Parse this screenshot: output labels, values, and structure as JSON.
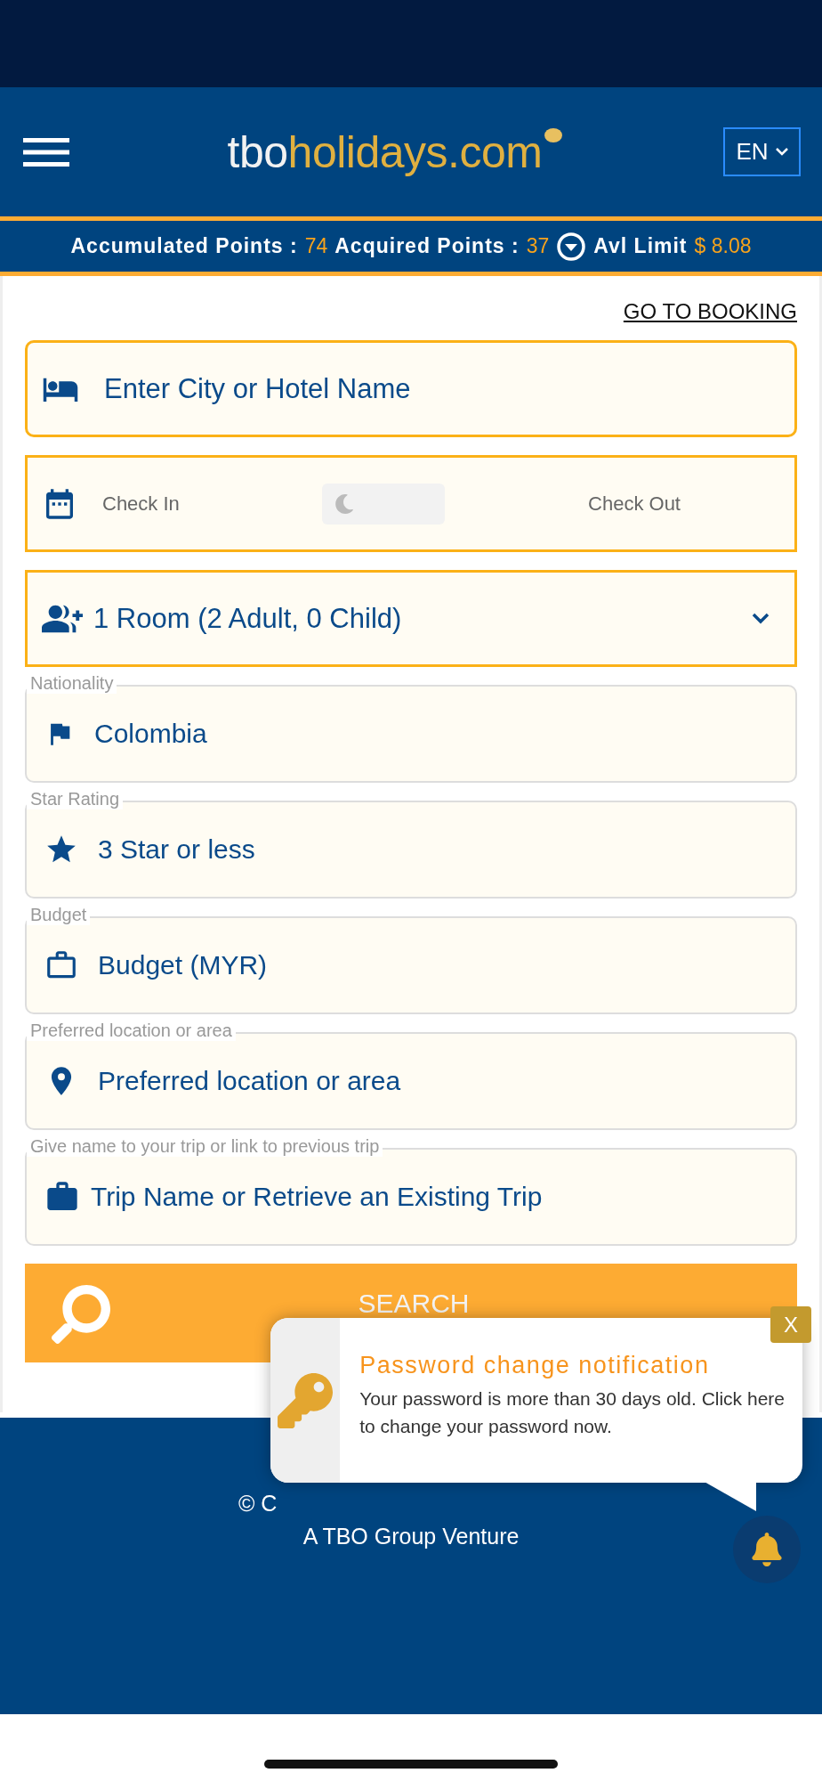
{
  "header": {
    "logo": {
      "part_1": "tbo",
      "part_2": "holidays.com"
    },
    "language": "EN"
  },
  "points_bar": {
    "items": [
      {
        "label": "Accumulated Points :",
        "value": "74"
      },
      {
        "label": "Acquired Points :",
        "value": "37"
      }
    ],
    "limit": {
      "label": "Avl Limit",
      "value": "$ 8.08"
    }
  },
  "go_to_booking": "GO TO BOOKING",
  "search_form": {
    "destination": {
      "placeholder": "Enter City or Hotel Name"
    },
    "dates": {
      "check_in": "Check In",
      "check_out": "Check Out"
    },
    "rooms": "1 Room (2 Adult, 0 Child)",
    "fields": [
      {
        "kind": "flag",
        "label": "Nationality",
        "value": "Colombia"
      },
      {
        "kind": "star",
        "label": "Star Rating",
        "value": "3 Star or less"
      },
      {
        "kind": "budget",
        "label": "Budget",
        "value": "Budget (MYR)"
      },
      {
        "kind": "location",
        "label": "Preferred location or area",
        "value": "Preferred location or area"
      },
      {
        "kind": "trip",
        "label": "Give name to your trip or link to previous trip",
        "value": "Trip Name or Retrieve an Existing Trip"
      }
    ],
    "search_button": "SEARCH"
  },
  "footer": {
    "copyright": "© C",
    "tagline": "A TBO Group Venture"
  },
  "notification": {
    "title": "Password change notification",
    "message": "Your password is more than 30 days old. Click here to change your password now.",
    "close": "X"
  }
}
